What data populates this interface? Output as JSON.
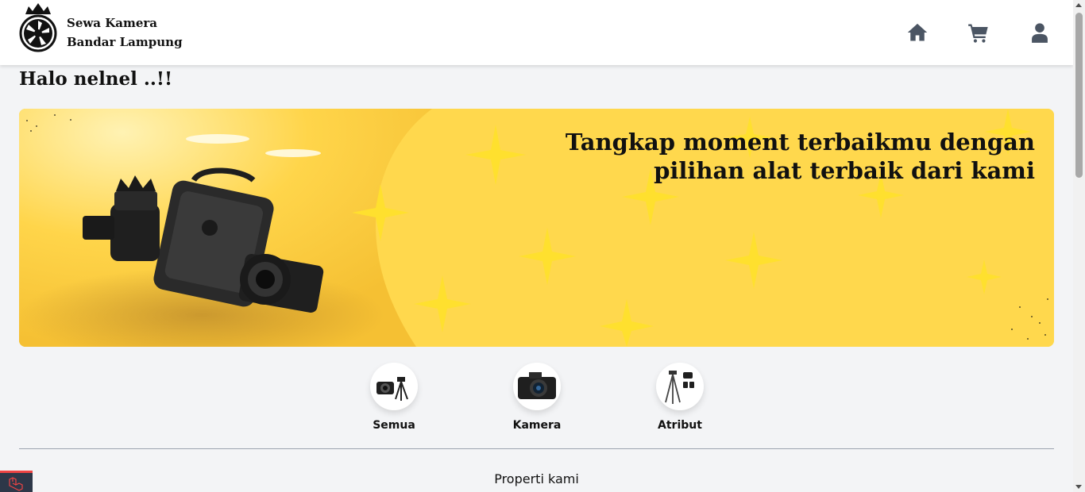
{
  "brand": {
    "line1": "Sewa Kamera",
    "line2": "Bandar Lampung"
  },
  "nav": {
    "icons": [
      "home-icon",
      "cart-icon",
      "user-icon"
    ]
  },
  "greeting": "Halo nelnel ..!!",
  "banner": {
    "line1": "Tangkap moment terbaikmu dengan",
    "line2": "pilihan alat terbaik dari kami"
  },
  "categories": [
    {
      "label": "Semua",
      "icon": "camera-tripod-icon"
    },
    {
      "label": "Kamera",
      "icon": "camera-icon"
    },
    {
      "label": "Atribut",
      "icon": "tripod-icon"
    }
  ],
  "section_title": "Properti kami",
  "colors": {
    "banner": "#ffd84d",
    "nav_icon": "#4b5563",
    "background": "#f3f4f6"
  }
}
